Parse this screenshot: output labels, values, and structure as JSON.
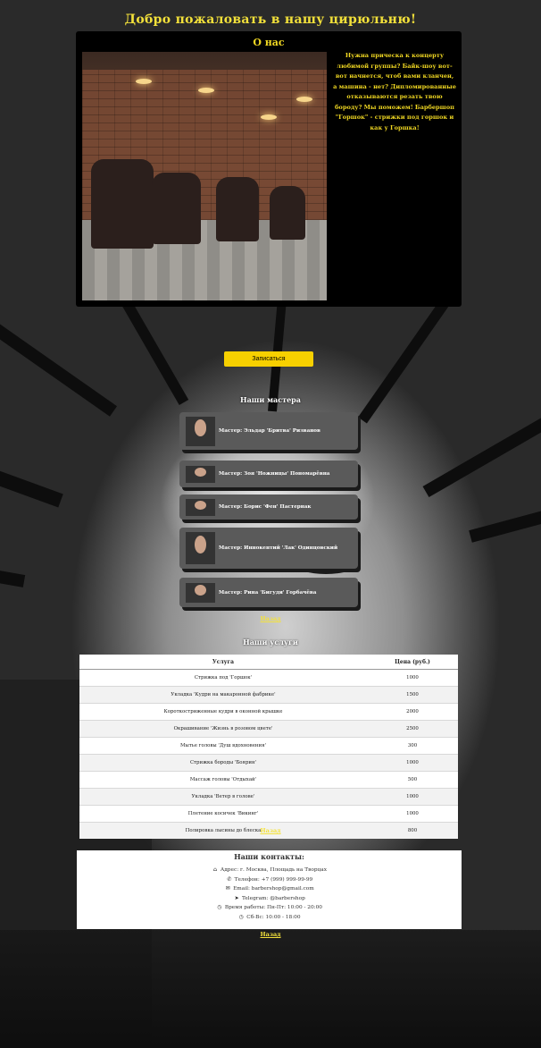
{
  "page": {
    "title": "Добро пожаловать в нашу цирюльню!"
  },
  "about": {
    "heading": "О нас",
    "text": "Нужна прическа к концерту любимой группы? Байк-шоу вот-вот начнется, чтоб вами кланчен, а машина - нет? Дипломированные отказываются резать твою бороду? Мы поможем! Барбершоп \"Горшок\" - стрижки под горшок и как у Горшка!",
    "photo_alt": "Интерьер барбершопа"
  },
  "signup_button": "Записаться",
  "masters": {
    "heading": "Наши мастера",
    "items": [
      {
        "label": "Мастер: Эльдар 'Бритва' Ризванов"
      },
      {
        "label": "Мастер: Зоя 'Ножницы' Пономарёвна"
      },
      {
        "label": "Мастер: Борис 'Фен' Пастернак"
      },
      {
        "label": "Мастер: Иннокентий 'Лак' Одинцовский"
      },
      {
        "label": "Мастер: Рина 'Бигуди' Горбачёва"
      }
    ],
    "back_link": "Назад"
  },
  "services": {
    "heading": "Наши услуги",
    "columns": [
      "Услуга",
      "Цена (руб.)"
    ],
    "rows": [
      [
        "Стрижка под 'Горшок'",
        "1000"
      ],
      [
        "Укладка 'Кудри на макаронной фабрике'",
        "1500"
      ],
      [
        "Короткостриженные кудри в оконной крышке",
        "2000"
      ],
      [
        "Окрашивание 'Жизнь в розовом цвете'",
        "2500"
      ],
      [
        "Мытье головы 'Душ вдохновения'",
        "300"
      ],
      [
        "Стрижка бороды 'Боярин'",
        "1000"
      ],
      [
        "Массаж головы 'Отдыхай'",
        "500"
      ],
      [
        "Укладка 'Ветер в голове'",
        "1000"
      ],
      [
        "Плетение косичек 'Викинг'",
        "1000"
      ],
      [
        "Полировка лысины до блеска",
        "800"
      ]
    ],
    "back_link": "Назад"
  },
  "contacts": {
    "heading": "Наши контакты:",
    "items": [
      {
        "icon": "home-icon",
        "text": "Адрес: г. Москва, Площадь на Творцах"
      },
      {
        "icon": "phone-icon",
        "text": "Телефон: +7 (999) 999-99-99"
      },
      {
        "icon": "mail-icon",
        "text": "Email: barbershop@gmail.com"
      },
      {
        "icon": "telegram-icon",
        "text": "Telegram: @barbershop"
      },
      {
        "icon": "clock-icon",
        "text": "Время работы: Пн-Пт: 10:00 - 20:00"
      },
      {
        "icon": "clock-icon",
        "text": "Сб-Вс: 10:00 - 18:00"
      }
    ],
    "back_link": "Назад"
  },
  "colors": {
    "accent_yellow": "#f7d000",
    "title_yellow": "#f2e03a",
    "card_gray": "#5a5a5a",
    "panel_black": "#000000"
  }
}
